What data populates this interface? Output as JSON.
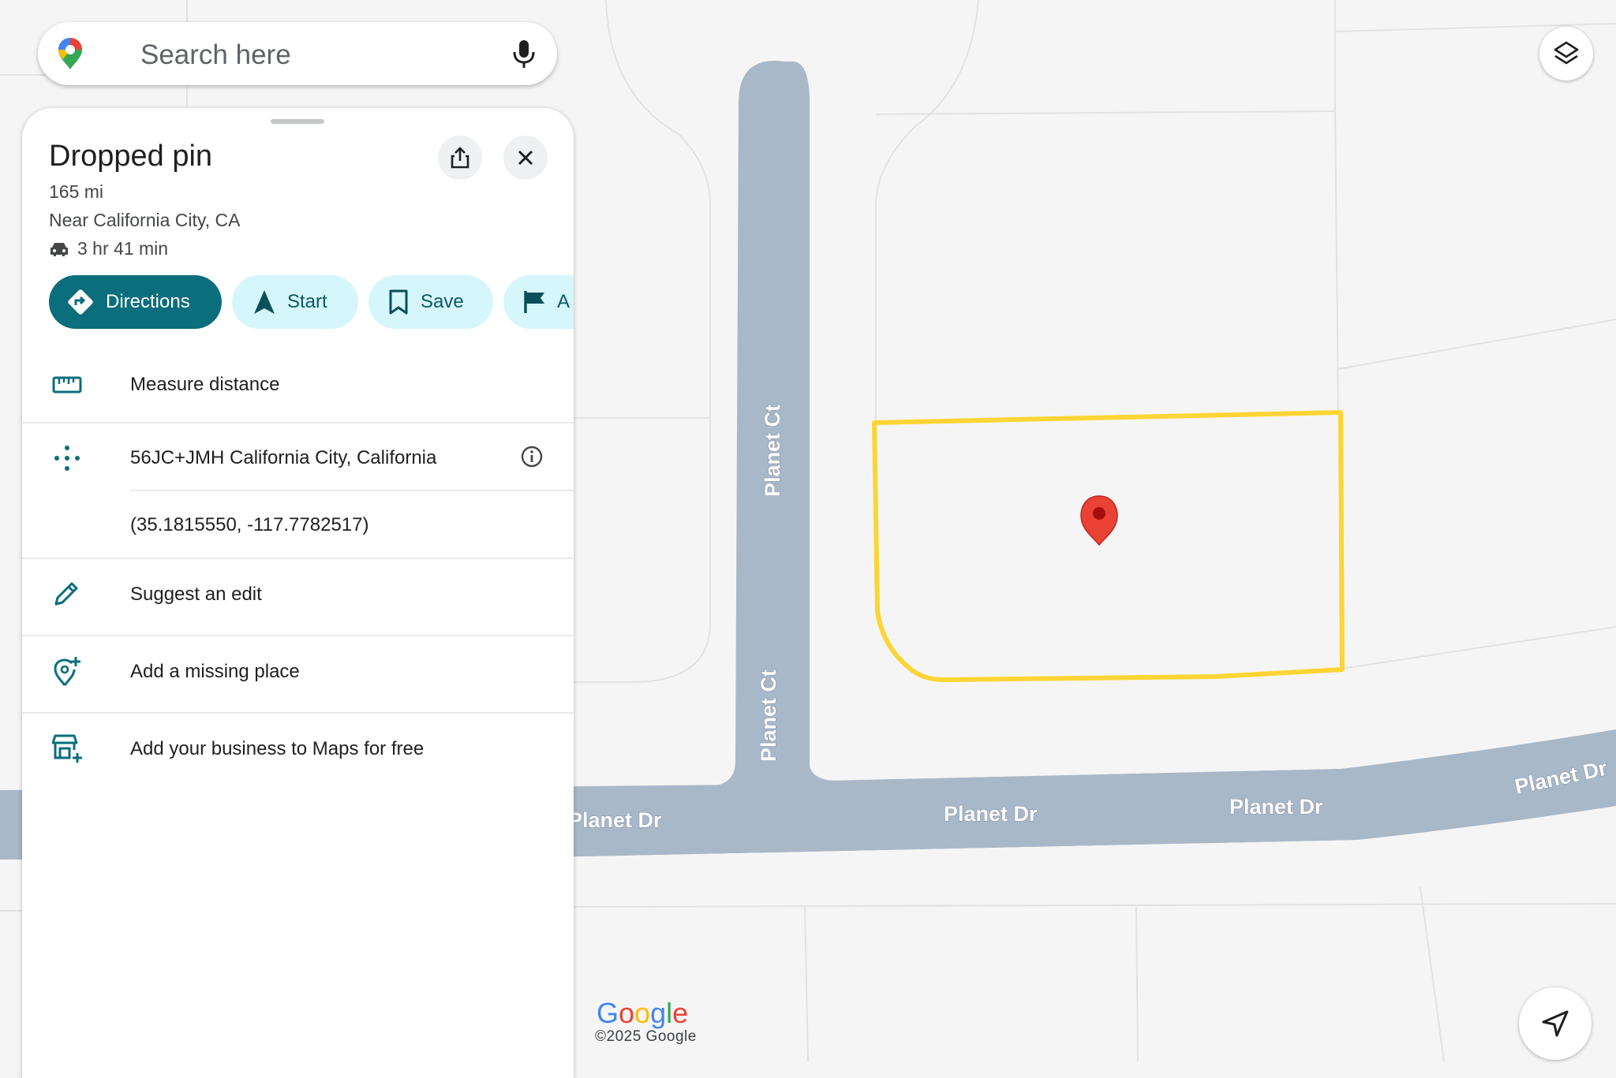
{
  "search": {
    "placeholder": "Search here"
  },
  "place": {
    "title": "Dropped pin",
    "distance": "165 mi",
    "near": "Near California City, CA",
    "drive_time": "3 hr 41 min"
  },
  "actions": [
    {
      "label": "Directions",
      "icon": "directions-icon"
    },
    {
      "label": "Start",
      "icon": "navigation-arrow-icon"
    },
    {
      "label": "Save",
      "icon": "bookmark-icon"
    },
    {
      "label": "A",
      "icon": "flag-icon"
    }
  ],
  "rows": {
    "measure": "Measure distance",
    "plus_code": "56JC+JMH California City, California",
    "coordinates": "(35.1815550, -117.7782517)",
    "suggest_edit": "Suggest an edit",
    "add_place": "Add a missing place",
    "add_business": "Add your business to Maps for free"
  },
  "map": {
    "street_labels": {
      "planet_ct_upper": "Planet Ct",
      "planet_ct_lower": "Planet Ct",
      "planet_dr_1": "Planet Dr",
      "planet_dr_2": "Planet Dr",
      "planet_dr_3": "Planet Dr",
      "planet_dr_4": "Planet Dr"
    },
    "colors": {
      "road": "#a9b8c8",
      "parcel_outline": "#fcd535",
      "pin": "#ea4335",
      "background": "#f6f5f5"
    }
  },
  "attribution": {
    "logo": "Google",
    "copyright": "©2025 Google"
  }
}
